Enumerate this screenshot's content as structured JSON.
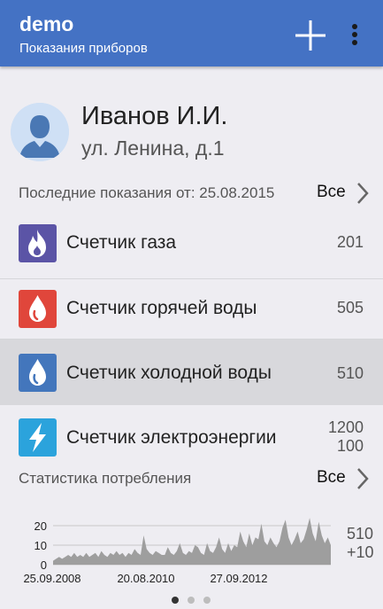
{
  "appbar": {
    "title": "demo",
    "subtitle": "Показания приборов",
    "color": "#4472c4",
    "actions": [
      "plus-icon",
      "more-vert-icon"
    ]
  },
  "profile": {
    "name": "Иванов И.И.",
    "address": "ул. Ленина, д.1"
  },
  "readings": {
    "label": "Последние показания от: 25.08.2015",
    "all_label": "Все"
  },
  "meters": [
    {
      "name": "Счетчик газа",
      "value": "201",
      "icon": "flame-icon",
      "color": "#5b54a6"
    },
    {
      "name": "Счетчик горячей воды",
      "value": "505",
      "icon": "drop-icon",
      "color": "#e0463b"
    },
    {
      "name": "Счетчик холодной воды",
      "value": "510",
      "icon": "drop-icon",
      "color": "#4376bc",
      "selected": true
    },
    {
      "name": "Счетчик электроэнергии",
      "value": "1200",
      "value2": "100",
      "icon": "lightning-icon",
      "color": "#2ba3dc"
    }
  ],
  "stats": {
    "label": "Статистика потребления",
    "all_label": "Все"
  },
  "chart_data": {
    "type": "area",
    "y_ticks": [
      "20",
      "10",
      "0"
    ],
    "ylim": [
      0,
      25
    ],
    "x_tick_labels": [
      "25.09.2008",
      "20.08.2010",
      "27.09.2012"
    ],
    "values": [
      2,
      3,
      4,
      3,
      4,
      5,
      4,
      6,
      4,
      5,
      4,
      6,
      4,
      5,
      6,
      4,
      7,
      5,
      4,
      6,
      5,
      7,
      5,
      6,
      4,
      6,
      5,
      8,
      6,
      5,
      15,
      8,
      6,
      5,
      7,
      6,
      5,
      5,
      9,
      6,
      5,
      7,
      11,
      6,
      5,
      7,
      6,
      10,
      9,
      6,
      5,
      11,
      7,
      6,
      9,
      14,
      8,
      6,
      11,
      7,
      10,
      9,
      17,
      12,
      9,
      16,
      10,
      14,
      13,
      21,
      12,
      10,
      14,
      11,
      9,
      12,
      19,
      23,
      14,
      10,
      13,
      17,
      11,
      13,
      18,
      24,
      16,
      12,
      22,
      15,
      11,
      14,
      10
    ],
    "current_value": "510",
    "delta": "+10",
    "series_color": "#9e9e9e"
  },
  "pager": {
    "count": 3,
    "active": 0
  }
}
